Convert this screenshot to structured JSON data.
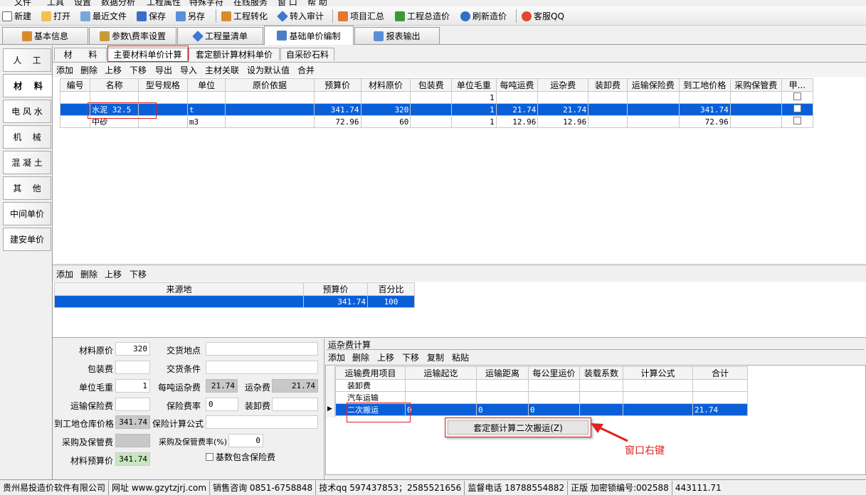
{
  "menubar": {
    "items": [
      "文件",
      "工具",
      "设置",
      "数据分析",
      "工程属性",
      "特殊字符",
      "在线服务",
      "窗 口",
      "帮 助"
    ]
  },
  "toolbar": {
    "items": [
      {
        "label": "新建",
        "icon": "new-doc-icon",
        "color": "#ffffff"
      },
      {
        "label": "打开",
        "icon": "folder-open-icon",
        "color": "#f2c14e"
      },
      {
        "label": "最近文件",
        "icon": "recent-files-icon",
        "color": "#7aa7d9"
      },
      {
        "label": "保存",
        "icon": "save-icon",
        "color": "#3a6fc9"
      },
      {
        "label": "另存",
        "icon": "save-as-icon",
        "color": "#5b8fd6"
      },
      {
        "label": "工程转化",
        "icon": "convert-icon",
        "color": "#d98b2b"
      },
      {
        "label": "转入审计",
        "icon": "audit-import-icon",
        "color": "#3f78d0"
      },
      {
        "label": "项目汇总",
        "icon": "summary-icon",
        "color": "#e07a2e"
      },
      {
        "label": "工程总造价",
        "icon": "home-icon",
        "color": "#3a9a3a"
      },
      {
        "label": "刷新造价",
        "icon": "refresh-icon",
        "color": "#2f70c8"
      },
      {
        "label": "客服QQ",
        "icon": "qq-penguin-icon",
        "color": "#e04a2a"
      }
    ]
  },
  "tabs": [
    {
      "label": "基本信息",
      "icon": "tools-icon"
    },
    {
      "label": "参数\\费率设置",
      "icon": "pencil-icon"
    },
    {
      "label": "工程量清单",
      "icon": "diamond-icon"
    },
    {
      "label": "基础单价编制",
      "icon": "list-icon",
      "active": true
    },
    {
      "label": "报表输出",
      "icon": "report-icon"
    }
  ],
  "left_tabs": [
    "人    工",
    "材    料",
    "电 风 水",
    "机    械",
    "混 凝 土",
    "其    他",
    "中间单价",
    "建安单价"
  ],
  "sub_tabs": [
    "材      料",
    "主要材料单价计算",
    "套定额计算材料单价",
    "自采砂石料"
  ],
  "main_actions": [
    "添加",
    "删除",
    "上移",
    "下移",
    "导出",
    "导入",
    "主材关联",
    "设为默认值",
    "合并"
  ],
  "material_table": {
    "headers": [
      "编号",
      "名称",
      "型号规格",
      "单位",
      "原价依据",
      "预算价",
      "材料原价",
      "包装费",
      "单位毛重",
      "每吨运费",
      "运杂费",
      "装卸费",
      "运输保险费",
      "到工地价格",
      "采购保管费",
      "甲..."
    ],
    "rows": [
      {
        "no": "",
        "name": "",
        "spec": "",
        "unit": "",
        "basis": "",
        "budget": "",
        "orig": "",
        "pack": "",
        "weight": "1",
        "ton_freight": "",
        "misc": "",
        "load": "",
        "insur": "",
        "site": "",
        "store": "",
        "checked": false
      },
      {
        "no": "",
        "name": "水泥 32.5",
        "spec": "",
        "unit": "t",
        "basis": "",
        "budget": "341.74",
        "orig": "320",
        "pack": "",
        "weight": "1",
        "ton_freight": "21.74",
        "misc": "21.74",
        "load": "",
        "insur": "",
        "site": "341.74",
        "store": "",
        "checked": false,
        "selected": true
      },
      {
        "no": "",
        "name": "中砂",
        "spec": "",
        "unit": "m3",
        "basis": "",
        "budget": "72.96",
        "orig": "60",
        "pack": "",
        "weight": "1",
        "ton_freight": "12.96",
        "misc": "12.96",
        "load": "",
        "insur": "",
        "site": "72.96",
        "store": "",
        "checked": false
      }
    ]
  },
  "source_actions": [
    "添加",
    "删除",
    "上移",
    "下移"
  ],
  "source_table": {
    "headers": [
      "来源地",
      "预算价",
      "百分比"
    ],
    "rows": [
      {
        "place": "",
        "budget": "341.74",
        "percent": "100"
      }
    ]
  },
  "form": {
    "orig_price": {
      "label": "材料原价",
      "value": "320"
    },
    "delivery_place": {
      "label": "交货地点",
      "value": ""
    },
    "package_fee": {
      "label": "包装费",
      "value": ""
    },
    "delivery_terms": {
      "label": "交货条件",
      "value": ""
    },
    "unit_weight": {
      "label": "单位毛重",
      "value": "1"
    },
    "per_ton_freight": {
      "label": "每吨运杂费",
      "value": "21.74"
    },
    "misc_freight": {
      "label": "运杂费",
      "value": "21.74"
    },
    "transport_insurance": {
      "label": "运输保险费",
      "value": ""
    },
    "insurance_rate": {
      "label": "保险费率",
      "value": "0"
    },
    "loading_fee": {
      "label": "装卸费",
      "value": ""
    },
    "site_price": {
      "label": "到工地仓库价格",
      "value": "341.74"
    },
    "insurance_formula": {
      "label": "保险计算公式",
      "value": ""
    },
    "purchase_storage": {
      "label": "采购及保管费",
      "value": ""
    },
    "purchase_rate": {
      "label": "采购及保管费率(%)",
      "value": "0"
    },
    "budget_price": {
      "label": "材料预算价",
      "value": "341.74"
    },
    "base_includes_insurance": {
      "label": "基数包含保险费",
      "checked": false
    }
  },
  "freight": {
    "title": "运杂费计算",
    "actions": [
      "添加",
      "删除",
      "上移",
      "下移",
      "复制",
      "粘贴"
    ],
    "headers": [
      "运输费用项目",
      "运输起讫",
      "运输距离",
      "每公里运价",
      "装载系数",
      "计算公式",
      "合计"
    ],
    "rows": [
      {
        "item": "装卸费",
        "route": "",
        "dist": "",
        "per_km": "",
        "coef": "",
        "formula": "",
        "total": ""
      },
      {
        "item": "汽车运输",
        "route": "",
        "dist": "",
        "per_km": "",
        "coef": "",
        "formula": "",
        "total": ""
      },
      {
        "item": "二次搬运",
        "route": "0",
        "dist": "0",
        "per_km": "0",
        "coef": "",
        "formula": "",
        "total": "21.74",
        "selected": true
      }
    ]
  },
  "context_menu": {
    "item": "套定额计算二次搬运(Z)"
  },
  "annotation": {
    "text": "窗口右键",
    "color": "#e02020"
  },
  "status": [
    "贵州易投造价软件有限公司",
    "网址 www.gzytzjrj.com",
    "销售咨询 0851-6758848",
    "技术qq 597437853；2585521656",
    "监督电话 18788554882",
    "正版 加密锁编号:002588",
    "443111.71"
  ]
}
